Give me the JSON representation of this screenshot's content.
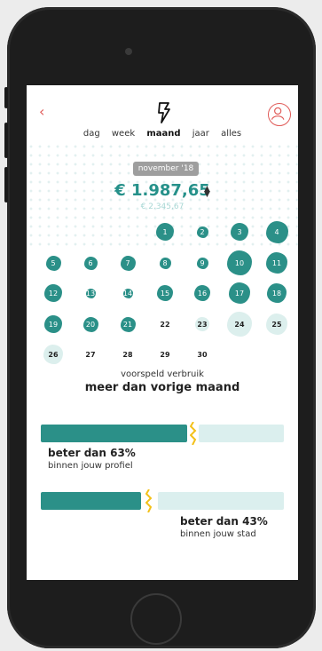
{
  "header": {
    "back_icon": "chevron-left-icon",
    "logo_icon": "lightning-icon",
    "profile_icon": "user-icon"
  },
  "tabs": [
    {
      "label": "dag",
      "active": false
    },
    {
      "label": "week",
      "active": false
    },
    {
      "label": "maand",
      "active": true
    },
    {
      "label": "jaar",
      "active": false
    },
    {
      "label": "alles",
      "active": false
    }
  ],
  "summary": {
    "period": "november '18",
    "amount": "€ 1.987,65",
    "sort_icon": "sort-arrows-icon",
    "previous_amount": "€ 2.345,67"
  },
  "calendar": {
    "days": [
      {
        "n": "1",
        "style": "filled"
      },
      {
        "n": "2",
        "style": "filled"
      },
      {
        "n": "3",
        "style": "filled"
      },
      {
        "n": "4",
        "style": "filled"
      },
      {
        "n": "5",
        "style": "filled"
      },
      {
        "n": "6",
        "style": "filled"
      },
      {
        "n": "7",
        "style": "filled"
      },
      {
        "n": "8",
        "style": "filled"
      },
      {
        "n": "9",
        "style": "filled"
      },
      {
        "n": "10",
        "style": "filled"
      },
      {
        "n": "11",
        "style": "filled"
      },
      {
        "n": "12",
        "style": "filled"
      },
      {
        "n": "13",
        "style": "filled"
      },
      {
        "n": "14",
        "style": "filled"
      },
      {
        "n": "15",
        "style": "filled"
      },
      {
        "n": "16",
        "style": "filled"
      },
      {
        "n": "17",
        "style": "filled"
      },
      {
        "n": "18",
        "style": "filled"
      },
      {
        "n": "19",
        "style": "filled"
      },
      {
        "n": "20",
        "style": "filled"
      },
      {
        "n": "21",
        "style": "filled"
      },
      {
        "n": "22",
        "style": "plain"
      },
      {
        "n": "23",
        "style": "light"
      },
      {
        "n": "24",
        "style": "light"
      },
      {
        "n": "25",
        "style": "light"
      },
      {
        "n": "26",
        "style": "light"
      },
      {
        "n": "27",
        "style": "plain"
      },
      {
        "n": "28",
        "style": "plain"
      },
      {
        "n": "29",
        "style": "plain"
      },
      {
        "n": "30",
        "style": "plain"
      }
    ]
  },
  "prediction": {
    "label": "voorspeld verbruik",
    "value": "meer dan vorige maand"
  },
  "comparisons": [
    {
      "title": "beter dan 63%",
      "subtitle": "binnen jouw profiel",
      "fill": 0.63
    },
    {
      "title": "beter dan 43%",
      "subtitle": "binnen jouw stad",
      "fill": 0.43
    }
  ],
  "colors": {
    "accent": "#2b9088",
    "accent_light": "#dbefee",
    "danger": "#e05a57",
    "zigzag": "#f3c11a"
  }
}
